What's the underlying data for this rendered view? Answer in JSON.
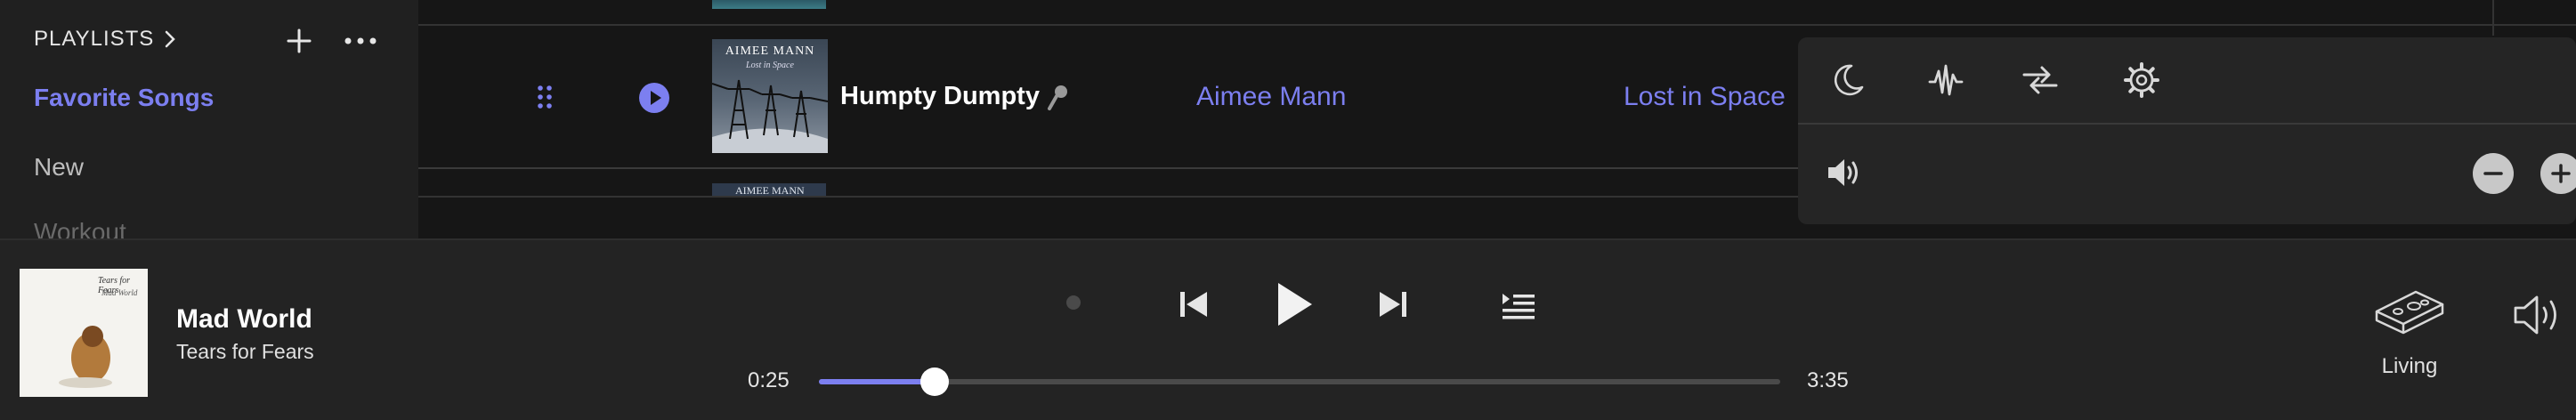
{
  "sidebar": {
    "header_label": "PLAYLISTS",
    "items": [
      {
        "label": "Favorite Songs",
        "active": true
      },
      {
        "label": "New"
      },
      {
        "label": "Workout"
      }
    ]
  },
  "tracklist": {
    "current_row": {
      "title": "Humpty Dumpty",
      "artist": "Aimee Mann",
      "album": "Lost in Space",
      "art_title": "AIMEE MANN",
      "art_subtitle": "Lost in Space"
    },
    "next_row_art_title": "AIMEE MANN"
  },
  "popup": {
    "icons": [
      "moon-icon",
      "waveform-icon",
      "swap-arrows-icon",
      "gear-icon",
      "volume-icon",
      "minus-icon",
      "plus-icon"
    ]
  },
  "player": {
    "now_playing": {
      "title": "Mad World",
      "artist": "Tears for Fears",
      "art_text_1": "Tears for Fears",
      "art_text_2": "Mad World"
    },
    "time_current": "0:25",
    "time_total": "3:35",
    "progress_fraction": 0.12,
    "device_label": "Living"
  },
  "colors": {
    "accent": "#7c7ff0",
    "background": "#161616",
    "sidebar": "#202020",
    "player_bar": "#232323",
    "popup": "#252525"
  }
}
